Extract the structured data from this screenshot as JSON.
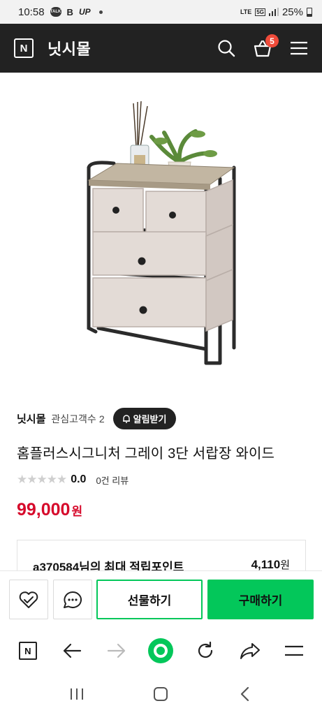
{
  "status_bar": {
    "time": "10:58",
    "talk_icon": "TALK",
    "b_icon": "B",
    "up_icon": "UP",
    "network": "LTE",
    "network_5g": "5G",
    "battery": "25%"
  },
  "header": {
    "logo": "N",
    "title": "닛시몰",
    "cart_count": "5"
  },
  "seller": {
    "name": "닛시몰",
    "follower_label": "관심고객수",
    "follower_count": "2",
    "alarm_button": "알림받기"
  },
  "product": {
    "title": "홈플러스시그니처 그레이 3단 서랍장 와이드",
    "rating": "0.0",
    "review_count": "0건 리뷰",
    "stars": "★★★★★",
    "price": "99,000",
    "currency": "원"
  },
  "points": {
    "label": "a370584님의 최대 적립포인트",
    "value": "4,110",
    "unit": "원"
  },
  "actions": {
    "gift": "선물하기",
    "buy": "구매하기"
  },
  "browser": {
    "home": "N"
  },
  "colors": {
    "header_bg": "#222222",
    "accent_green": "#03c75a",
    "price_red": "#d60a2b",
    "badge_red": "#f04b3a"
  }
}
